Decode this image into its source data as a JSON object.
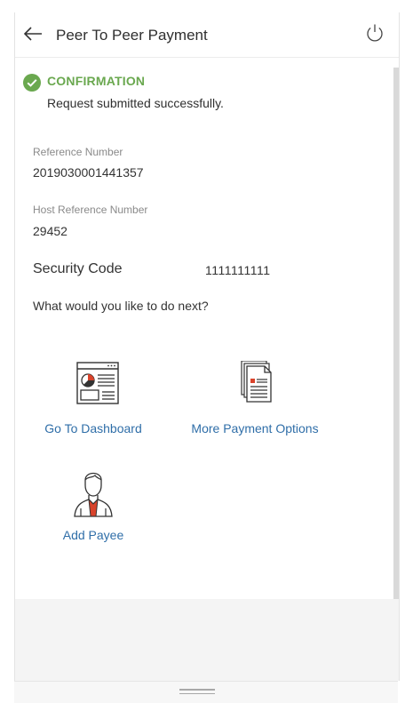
{
  "header": {
    "title": "Peer To Peer Payment"
  },
  "confirmation": {
    "title": "CONFIRMATION",
    "message": "Request submitted successfully."
  },
  "details": {
    "reference_label": "Reference Number",
    "reference_value": "2019030001441357",
    "host_reference_label": "Host Reference Number",
    "host_reference_value": "29452",
    "security_label": "Security Code",
    "security_value": "1111111111"
  },
  "next_prompt": "What would you like to do next?",
  "actions": [
    {
      "label": "Go To Dashboard",
      "icon": "dashboard-icon"
    },
    {
      "label": "More Payment Options",
      "icon": "documents-icon"
    },
    {
      "label": "Add Payee",
      "icon": "payee-person-icon"
    }
  ],
  "colors": {
    "success": "#6aa84f",
    "link": "#2f6ea8",
    "accent_red": "#d9432b"
  }
}
